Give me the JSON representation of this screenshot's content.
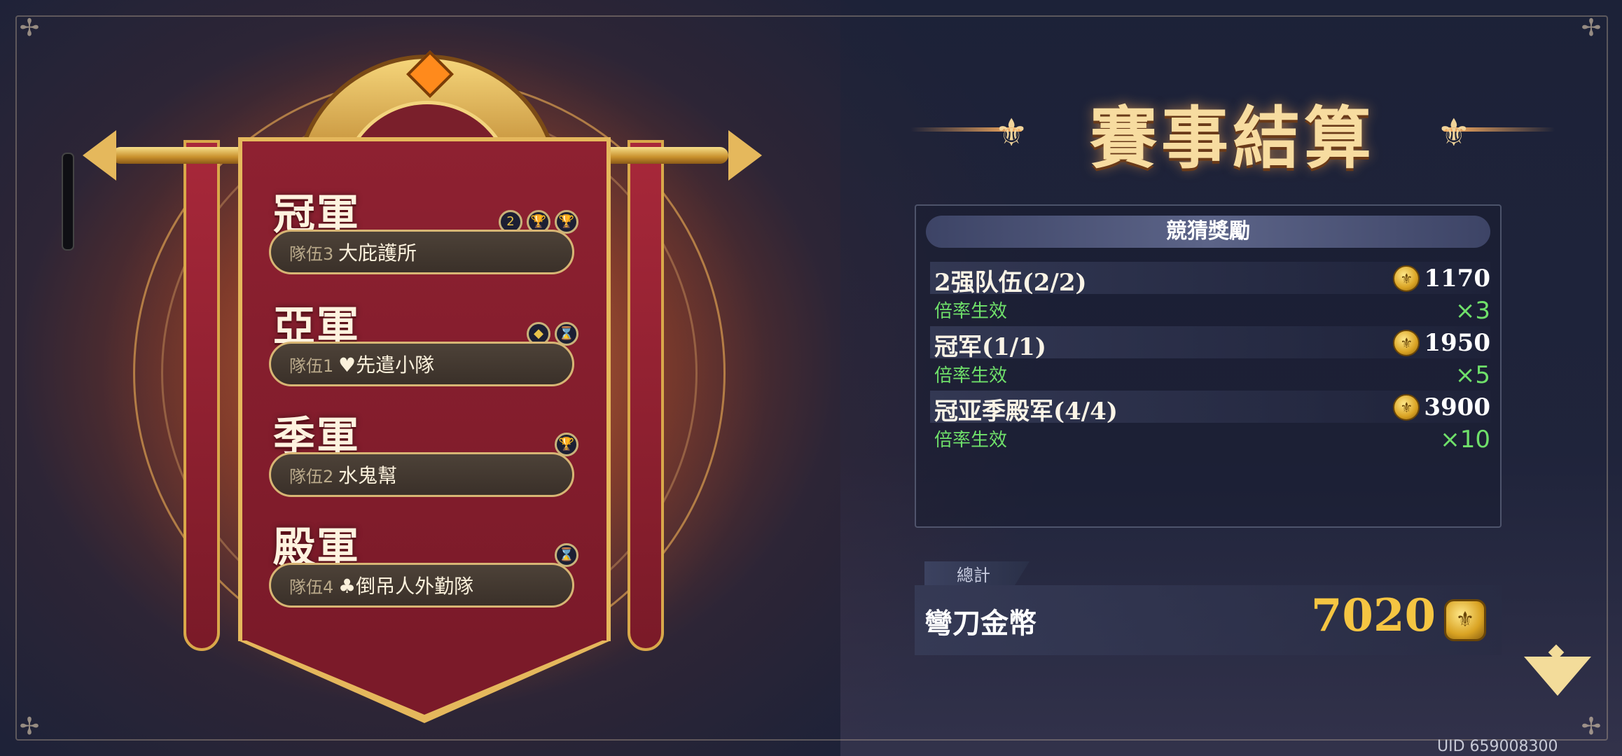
{
  "results": {
    "places": [
      {
        "title": "冠軍",
        "slot": "隊伍3",
        "team": "大庇護所",
        "badges": [
          "2",
          "🏆",
          "🏆"
        ]
      },
      {
        "title": "亞軍",
        "slot": "隊伍1",
        "team": "♥先遣小隊",
        "badges": [
          "◆",
          "⌛"
        ]
      },
      {
        "title": "季軍",
        "slot": "隊伍2",
        "team": "水鬼幫",
        "badges": [
          "🏆"
        ]
      },
      {
        "title": "殿軍",
        "slot": "隊伍4",
        "team": "♣倒吊人外勤隊",
        "badges": [
          "⌛"
        ]
      }
    ]
  },
  "header": {
    "title": "賽事結算"
  },
  "rewards_panel": {
    "heading": "競猜獎勵",
    "items": [
      {
        "name": "2强队伍(2/2)",
        "amount": "1170",
        "status": "倍率生效",
        "multiplier": "×3"
      },
      {
        "name": "冠军(1/1)",
        "amount": "1950",
        "status": "倍率生效",
        "multiplier": "×5"
      },
      {
        "name": "冠亚季殿军(4/4)",
        "amount": "3900",
        "status": "倍率生效",
        "multiplier": "×10"
      }
    ]
  },
  "total": {
    "label": "總計",
    "currency": "彎刀金幣",
    "value": "7020"
  },
  "footer": {
    "uid": "UID 659008300"
  },
  "colors": {
    "accent_gold": "#f5c542",
    "multiplier_green": "#6fe06a",
    "banner_red": "#7b1a29"
  }
}
